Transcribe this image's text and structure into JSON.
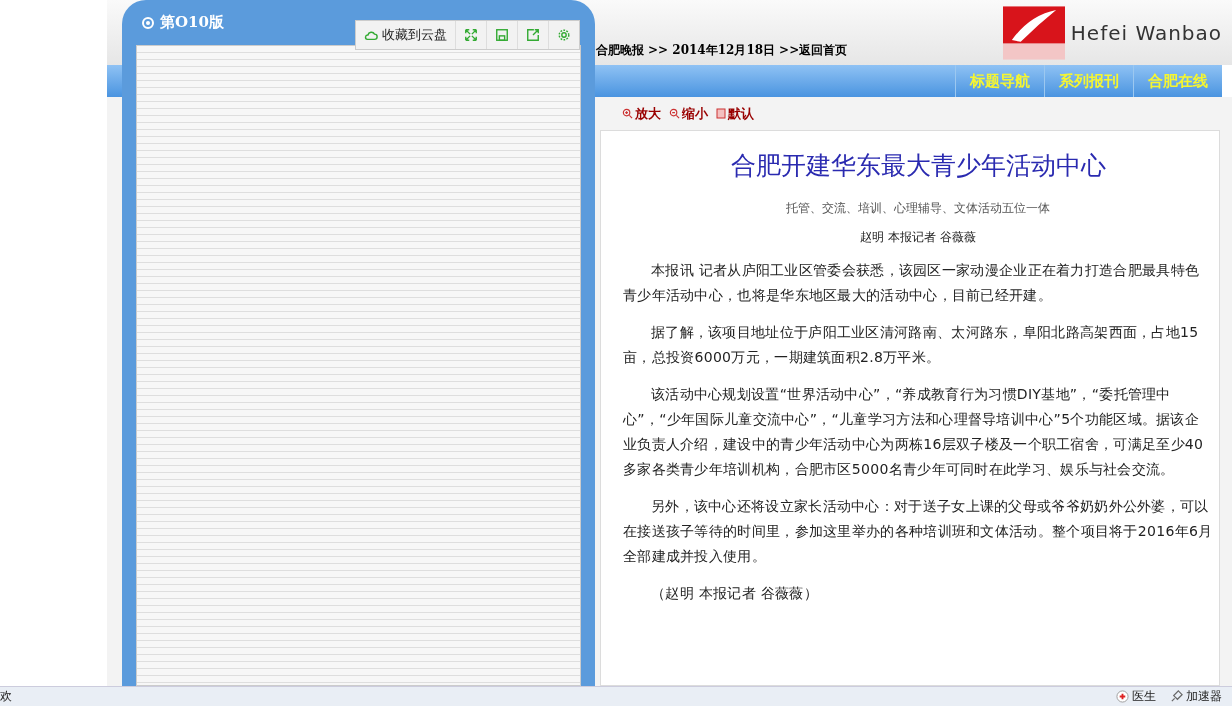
{
  "viewer": {
    "edition": "第O10版",
    "toolbar": {
      "save_label": "收藏到云盘"
    }
  },
  "header": {
    "logo_text": "Hefei Wanbao",
    "breadcrumb": [
      "合肥晚报",
      ">> 2014年12月18日",
      ">>返回首页"
    ]
  },
  "nav": [
    "标题导航",
    "系列报刊",
    "合肥在线"
  ],
  "zoom_controls": [
    {
      "kind": "zoom-in",
      "label": "放大"
    },
    {
      "kind": "zoom-out",
      "label": "缩小"
    },
    {
      "kind": "default",
      "label": "默认"
    }
  ],
  "article": {
    "title": "合肥开建华东最大青少年活动中心",
    "subtitle": "托管、交流、培训、心理辅导、文体活动五位一体",
    "byline": "赵明  本报记者 谷薇薇",
    "paragraphs": [
      "本报讯  记者从庐阳工业区管委会获悉，该园区一家动漫企业正在着力打造合肥最具特色青少年活动中心，也将是华东地区最大的活动中心，目前已经开建。",
      "据了解，该项目地址位于庐阳工业区清河路南、太河路东，阜阳北路高架西面，占地15亩，总投资6000万元，一期建筑面积2.8万平米。",
      "该活动中心规划设置“世界活动中心”，“养成教育行为习惯DIY基地”，“委托管理中心”，“少年国际儿童交流中心”，“儿童学习方法和心理督导培训中心”5个功能区域。据该企业负责人介绍，建设中的青少年活动中心为两栋16层双子楼及一个职工宿舍，可满足至少40多家各类青少年培训机构，合肥市区5000名青少年可同时在此学习、娱乐与社会交流。",
      "另外，该中心还将设立家长活动中心：对于送子女上课的父母或爷爷奶奶外公外婆，可以在接送孩子等待的时间里，参加这里举办的各种培训班和文体活动。整个项目将于2016年6月全部建成并投入使用。",
      "（赵明 本报记者 谷薇薇）"
    ]
  },
  "status_bar": {
    "left": "欢",
    "right": [
      {
        "kind": "doctor",
        "label": "医生"
      },
      {
        "kind": "accelerator",
        "label": "加速器"
      }
    ]
  }
}
